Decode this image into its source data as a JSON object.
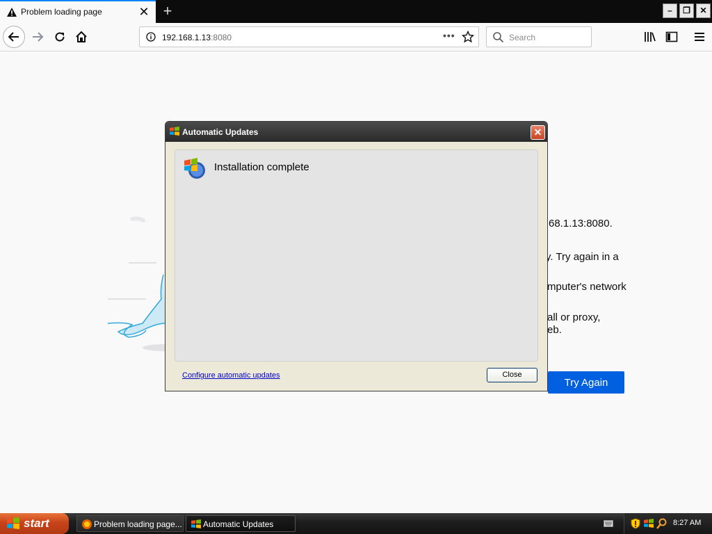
{
  "browser": {
    "tab_title": "Problem loading page",
    "url_host": "192.168.1.13",
    "url_port": ":8080",
    "search_placeholder": "Search"
  },
  "error_page": {
    "lines": [
      "68.1.13:8080.",
      "y. Try again in a",
      "mputer's network",
      "all or proxy,",
      "eb."
    ],
    "try_again_label": "Try Again"
  },
  "dialog": {
    "title": "Automatic Updates",
    "message": "Installation complete",
    "configure_link": "Configure automatic updates",
    "close_label": "Close"
  },
  "taskbar": {
    "start_label": "start",
    "items": [
      {
        "label": "Problem loading page..."
      },
      {
        "label": "Automatic Updates"
      }
    ],
    "clock": "8:27 AM"
  },
  "colors": {
    "accent": "#0a84ff",
    "try_again": "#0060df",
    "dialog_title": "#2b2b2b",
    "start": "#c8431a"
  }
}
